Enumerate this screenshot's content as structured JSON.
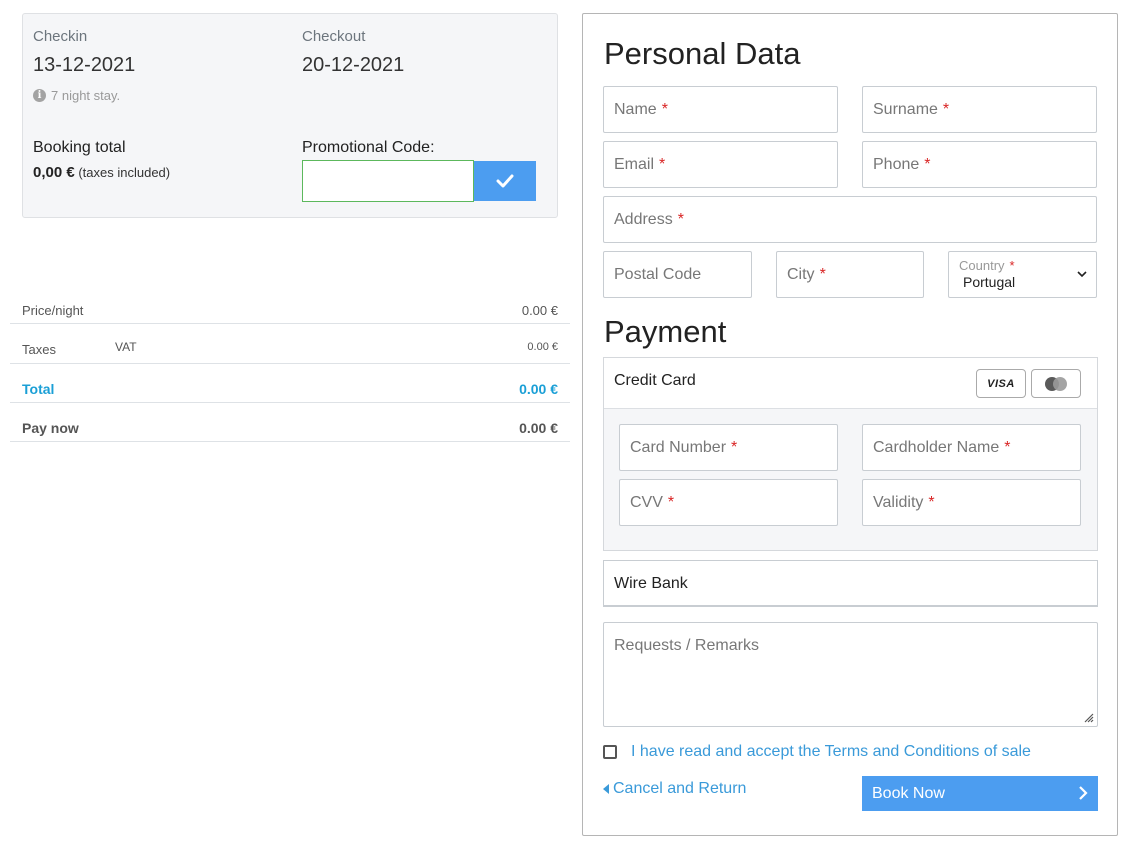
{
  "booking": {
    "checkin_label": "Checkin",
    "checkin_value": "13-12-2021",
    "checkout_label": "Checkout",
    "checkout_value": "20-12-2021",
    "nights_text": "7 night stay.",
    "total_label": "Booking total",
    "total_amount": "0,00 €",
    "total_note": "(taxes included)",
    "promo_label": "Promotional Code:",
    "promo_value": ""
  },
  "summary": {
    "price_label": "Price/night",
    "price_value": "0.00 €",
    "taxes_label": "Taxes",
    "vat_label": "VAT",
    "vat_value": "0.00 €",
    "total_label": "Total",
    "total_value": "0.00 €",
    "paynow_label": "Pay now",
    "paynow_value": "0.00 €"
  },
  "personal": {
    "title": "Personal Data",
    "name": "Name",
    "surname": "Surname",
    "email": "Email",
    "phone": "Phone",
    "address": "Address",
    "postal_code": "Postal Code",
    "city": "City",
    "country_label": "Country",
    "country_value": "Portugal",
    "required_mark": "*"
  },
  "payment": {
    "title": "Payment",
    "credit_card_label": "Credit Card",
    "visa_text": "VISA",
    "card_number": "Card Number",
    "cardholder_name": "Cardholder Name",
    "cvv": "CVV",
    "validity": "Validity",
    "wire_bank_label": "Wire Bank"
  },
  "remarks_placeholder": "Requests / Remarks",
  "terms_text": "I have read and accept the Terms and Conditions of sale",
  "cancel_label": "Cancel and Return",
  "book_label": "Book Now",
  "colors": {
    "accent": "#4c9df0",
    "link": "#3a9ad9",
    "total": "#1a9fd6",
    "required": "#d92525",
    "promo_border": "#5cb85c"
  },
  "icons": {
    "info": "info-circle-icon",
    "check": "check-icon",
    "select": "chevron-down-icon",
    "visa": "visa-card-icon",
    "mastercard": "mastercard-icon",
    "cancel": "caret-left-icon",
    "book": "chevron-right-icon"
  }
}
